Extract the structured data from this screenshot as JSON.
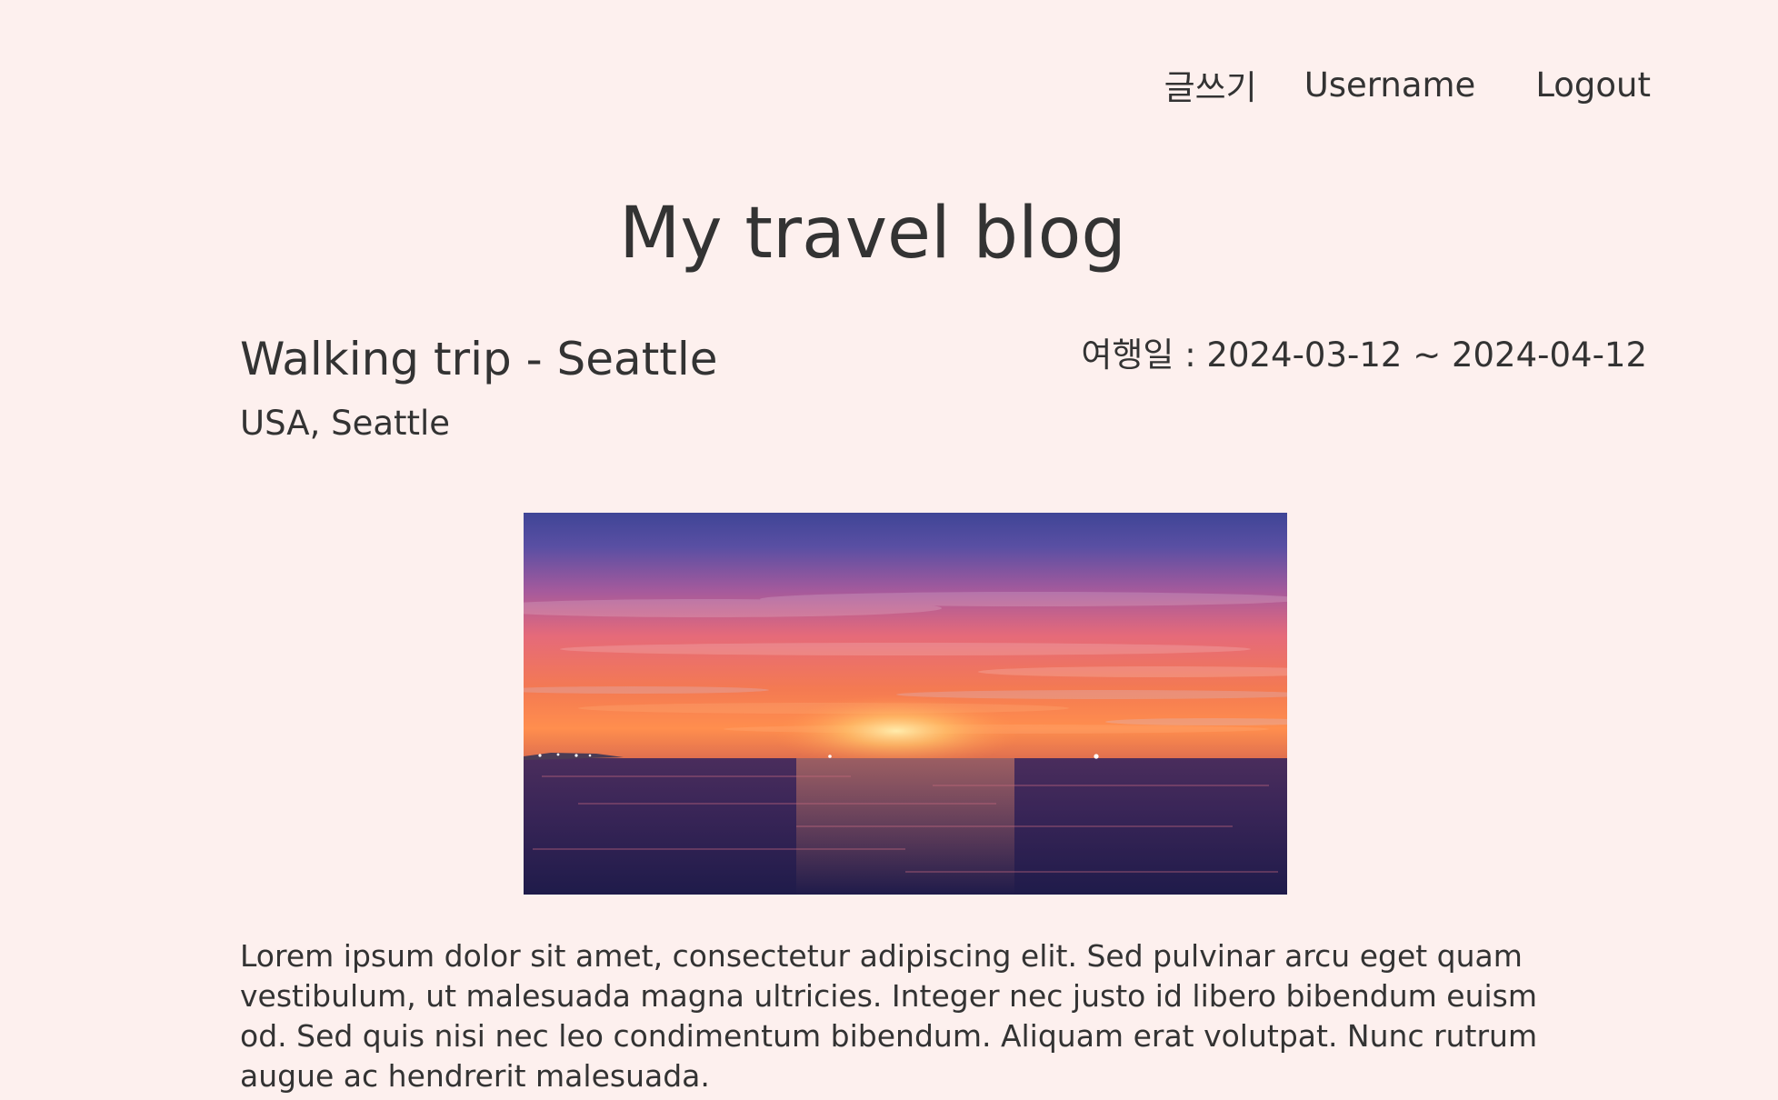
{
  "nav": {
    "write": "글쓰기",
    "username": "Username",
    "logout": "Logout"
  },
  "blog": {
    "title": "My travel blog"
  },
  "post": {
    "title": "Walking trip - Seattle",
    "location": "USA, Seattle",
    "dates": "여행일 : 2024-03-12 ~ 2024-04-12",
    "body": "Lorem ipsum dolor sit amet, consectetur adipiscing elit. Sed pulvinar arcu eget quam vestibulum, ut malesuada magna ultricies. Integer nec justo id libero bibendum euismod. Sed quis nisi nec leo condimentum bibendum. Aliquam erat volutpat. Nunc rutrum augue ac hendrerit malesuada."
  },
  "colors": {
    "background": "#fdf0ee",
    "text": "#333333"
  }
}
